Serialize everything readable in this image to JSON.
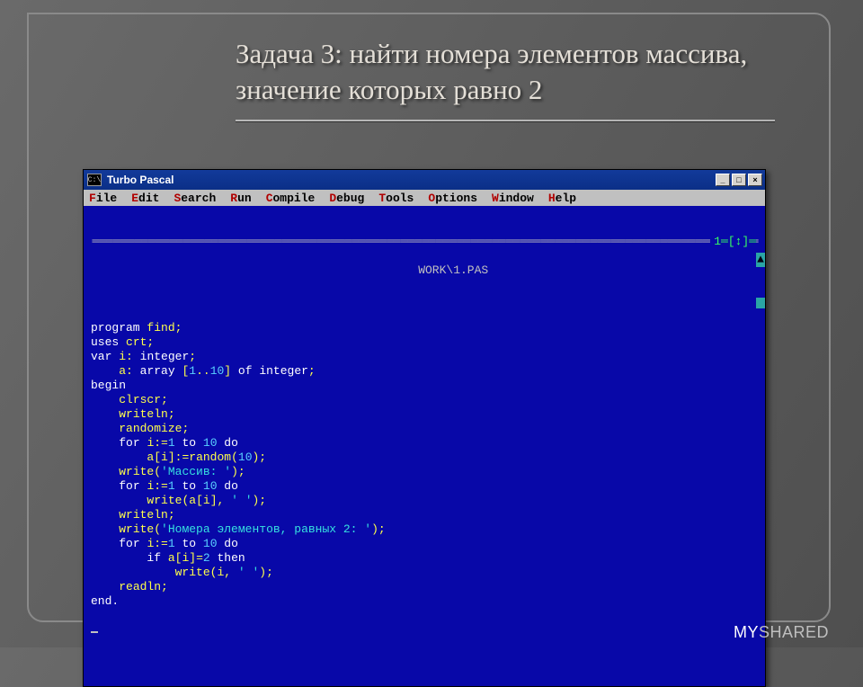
{
  "slide": {
    "title": "Задача 3: найти номера элементов массива, значение которых равно 2",
    "watermark_my": "MY",
    "watermark_shared": "SHARED"
  },
  "window": {
    "app_icon_text": "C:\\",
    "title": "Turbo Pascal",
    "buttons": {
      "min": "_",
      "max": "□",
      "close": "×"
    }
  },
  "menu": [
    {
      "hot": "F",
      "rest": "ile"
    },
    {
      "hot": "E",
      "rest": "dit"
    },
    {
      "hot": "S",
      "rest": "earch"
    },
    {
      "hot": "R",
      "rest": "un"
    },
    {
      "hot": "C",
      "rest": "ompile"
    },
    {
      "hot": "D",
      "rest": "ebug"
    },
    {
      "hot": "T",
      "rest": "ools"
    },
    {
      "hot": "O",
      "rest": "ptions"
    },
    {
      "hot": "W",
      "rest": "indow"
    },
    {
      "hot": "H",
      "rest": "elp"
    }
  ],
  "tui": {
    "file_label": " WORK\\1.PAS ",
    "right_label": "1═[↕]═",
    "scroll_up": "▲"
  },
  "code": {
    "l1": {
      "a": "program ",
      "b": "find",
      "c": ";"
    },
    "l2": {
      "a": "uses ",
      "b": "crt",
      "c": ";"
    },
    "l3": {
      "a": "var ",
      "b": "i",
      "c": ": ",
      "d": "integer",
      "e": ";"
    },
    "l4": {
      "a": "    ",
      "b": "a",
      "c": ": ",
      "d": "array ",
      "e": "[",
      "f": "1",
      "g": "..",
      "h": "10",
      "i": "] ",
      "j": "of ",
      "k": "integer",
      "l": ";"
    },
    "l5": {
      "a": "begin"
    },
    "l6": {
      "a": "    ",
      "b": "clrscr",
      "c": ";"
    },
    "l7": {
      "a": "    ",
      "b": "writeln",
      "c": ";"
    },
    "l8": {
      "a": "    ",
      "b": "randomize",
      "c": ";"
    },
    "l9": {
      "a": "    ",
      "b": "for ",
      "c": "i",
      "d": ":=",
      "e": "1",
      "f": " to ",
      "g": "10",
      "h": " do"
    },
    "l10": {
      "a": "        ",
      "b": "a",
      "c": "[",
      "d": "i",
      "e": "]:=",
      "f": "random",
      "g": "(",
      "h": "10",
      "i": ");"
    },
    "l11": {
      "a": "    ",
      "b": "write",
      "c": "(",
      "d": "'Массив: '",
      "e": ");"
    },
    "l12": {
      "a": "    ",
      "b": "for ",
      "c": "i",
      "d": ":=",
      "e": "1",
      "f": " to ",
      "g": "10",
      "h": " do"
    },
    "l13": {
      "a": "        ",
      "b": "write",
      "c": "(",
      "d": "a",
      "e": "[",
      "f": "i",
      "g": "], ",
      "h": "' '",
      "i": ");"
    },
    "l14": {
      "a": "    ",
      "b": "writeln",
      "c": ";"
    },
    "l15": {
      "a": "    ",
      "b": "write",
      "c": "(",
      "d": "'Номера элементов, равных 2: '",
      "e": ");"
    },
    "l16": {
      "a": "    ",
      "b": "for ",
      "c": "i",
      "d": ":=",
      "e": "1",
      "f": " to ",
      "g": "10",
      "h": " do"
    },
    "l17": {
      "a": "        ",
      "b": "if ",
      "c": "a",
      "d": "[",
      "e": "i",
      "f": "]=",
      "g": "2",
      "h": " then"
    },
    "l18": {
      "a": "            ",
      "b": "write",
      "c": "(",
      "d": "i",
      "e": ", ",
      "f": "' '",
      "g": ");"
    },
    "l19": {
      "a": "    ",
      "b": "readln",
      "c": ";"
    },
    "l20": {
      "a": "end."
    }
  }
}
